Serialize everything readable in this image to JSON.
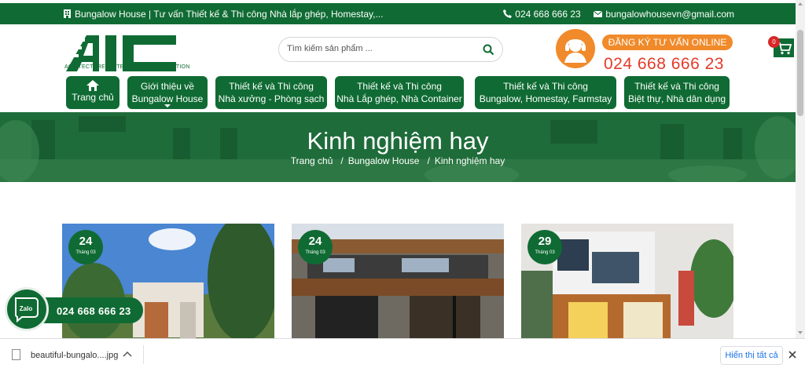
{
  "topbar": {
    "site_title": "Bungalow House | Tư vấn Thiết kế & Thi công Nhà lắp ghép, Homestay,...",
    "phone": "024 668 666 23",
    "email": "bungalowhousevn@gmail.com",
    "home_icon": "building-icon",
    "phone_icon": "phone-icon",
    "email_icon": "envelope-icon"
  },
  "logo": {
    "text": "AIC",
    "tagline": "ACHITECTURE - INTERIOR - CONSTRUCTION"
  },
  "search": {
    "placeholder": "Tìm kiếm sản phẩm ..."
  },
  "hotline": {
    "cta_label": "ĐĂNG KÝ TƯ VẤN ONLINE",
    "phone": "024 668 666 23"
  },
  "cart": {
    "count": "0"
  },
  "nav": {
    "items": [
      {
        "line1": "",
        "line2": "Trang chủ"
      },
      {
        "line1": "Giới thiệu về",
        "line2": "Bungalow House"
      },
      {
        "line1": "Thiết kế và Thi công",
        "line2": "Nhà xưởng - Phòng sạch"
      },
      {
        "line1": "Thiết kế và Thi công",
        "line2": "Nhà Lắp ghép, Nhà Container"
      },
      {
        "line1": "Thiết kế và Thi công",
        "line2": "Bungalow, Homestay, Farmstay"
      },
      {
        "line1": "Thiết kế và Thi công",
        "line2": "Biệt thự, Nhà dân dụng"
      }
    ]
  },
  "banner": {
    "title": "Kinh nghiệm hay",
    "breadcrumb": [
      "Trang chủ",
      "Bungalow House",
      "Kinh nghiệm hay"
    ],
    "separator": "/"
  },
  "posts": [
    {
      "day": "24",
      "month": "Tháng 03"
    },
    {
      "day": "24",
      "month": "Tháng 03"
    },
    {
      "day": "29",
      "month": "Tháng 03"
    }
  ],
  "zalo": {
    "label": "Zalo",
    "phone": "024 668 666 23"
  },
  "download_bar": {
    "file_name": "beautiful-bungalo....jpg",
    "show_all": "Hiển thị tất cả"
  },
  "colors": {
    "brand_green": "#0f6b33",
    "accent_orange": "#f08a2a",
    "hotline_red": "#e23b2a"
  }
}
